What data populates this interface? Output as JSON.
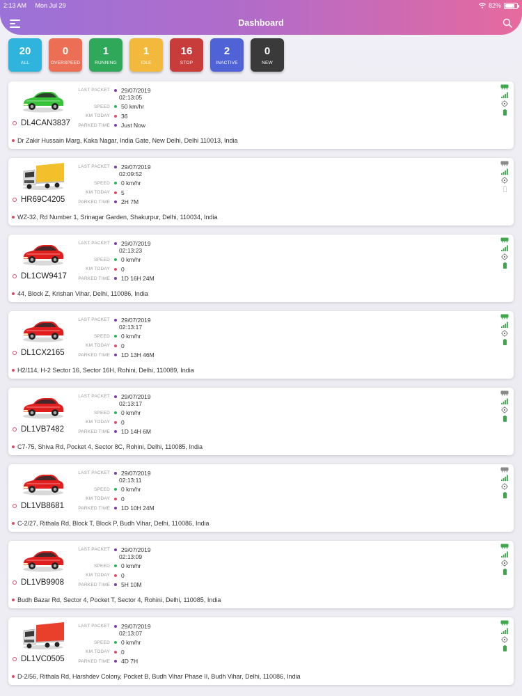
{
  "status_bar": {
    "time": "2:13 AM",
    "date": "Mon Jul 29",
    "battery": "82%",
    "battery_level": 0.82
  },
  "header": {
    "title": "Dashboard"
  },
  "tiles": [
    {
      "count": "20",
      "label": "ALL",
      "color": "#2fb4dd"
    },
    {
      "count": "0",
      "label": "OVERSPEED",
      "color": "#ec6f55"
    },
    {
      "count": "1",
      "label": "RUNNING",
      "color": "#2fa85a"
    },
    {
      "count": "1",
      "label": "IDLE",
      "color": "#f2b93d"
    },
    {
      "count": "16",
      "label": "STOP",
      "color": "#c93c3c"
    },
    {
      "count": "2",
      "label": "INACTIVE",
      "color": "#4f63d6"
    },
    {
      "count": "0",
      "label": "NEW",
      "color": "#3a3a3a"
    }
  ],
  "labels": {
    "last_packet": "LAST PACKET",
    "speed": "SPEED",
    "km_today": "KM TODAY",
    "parked_time": "PARKED TIME"
  },
  "colors": {
    "dot_last_packet": "#7a3fa0",
    "dot_speed": "#2fb45a",
    "dot_km": "#e24a6a",
    "dot_parked": "#7a3fa0",
    "gps_active": "#3fa64b",
    "gps_inactive": "#8a8a8a",
    "signal": "#3fa64b",
    "battery_on": "#3fa64b",
    "battery_off": "#bdbdbd"
  },
  "vehicles": [
    {
      "type": "car",
      "color": "#37c23a",
      "plate": "DL4CAN3837",
      "date": "29/07/2019",
      "time": "02:13:05",
      "speed": "50 km/hr",
      "km_today": "36",
      "parked": "Just Now",
      "address": "Dr Zakir Hussain Marg, Kaka Nagar, India Gate, New Delhi, Delhi 110013, India",
      "gps": "active",
      "battery": "on"
    },
    {
      "type": "truck",
      "color": "#f2c02a",
      "plate": "HR69C4205",
      "date": "29/07/2019",
      "time": "02:09:52",
      "speed": "0 km/hr",
      "km_today": "5",
      "parked": "2H 7M",
      "address": "WZ-32, Rd Number 1, Srinagar Garden, Shakurpur, Delhi, 110034, India",
      "gps": "inactive",
      "battery": "off"
    },
    {
      "type": "car",
      "color": "#e01e1e",
      "plate": "DL1CW9417",
      "date": "29/07/2019",
      "time": "02:13:23",
      "speed": "0 km/hr",
      "km_today": "0",
      "parked": "1D 16H 24M",
      "address": "44, Block Z, Krishan Vihar, Delhi, 110086, India",
      "gps": "active",
      "battery": "on"
    },
    {
      "type": "car",
      "color": "#e01e1e",
      "plate": "DL1CX2165",
      "date": "29/07/2019",
      "time": "02:13:17",
      "speed": "0 km/hr",
      "km_today": "0",
      "parked": "1D 13H 46M",
      "address": "H2/114, H-2 Sector 16, Sector 16H, Rohini, Delhi, 110089, India",
      "gps": "active",
      "battery": "on"
    },
    {
      "type": "car",
      "color": "#e01e1e",
      "plate": "DL1VB7482",
      "date": "29/07/2019",
      "time": "02:13:17",
      "speed": "0 km/hr",
      "km_today": "0",
      "parked": "1D 14H 6M",
      "address": "C7-75, Shiva Rd, Pocket 4, Sector 8C, Rohini, Delhi, 110085, India",
      "gps": "inactive",
      "battery": "on"
    },
    {
      "type": "car",
      "color": "#e01e1e",
      "plate": "DL1VB8681",
      "date": "29/07/2019",
      "time": "02:13:11",
      "speed": "0 km/hr",
      "km_today": "0",
      "parked": "1D 10H 24M",
      "address": "C-2/27, Rithala Rd, Block T, Block P, Budh Vihar, Delhi, 110086, India",
      "gps": "inactive",
      "battery": "on"
    },
    {
      "type": "car",
      "color": "#e01e1e",
      "plate": "DL1VB9908",
      "date": "29/07/2019",
      "time": "02:13:09",
      "speed": "0 km/hr",
      "km_today": "0",
      "parked": "5H 10M",
      "address": "Budh Bazar Rd, Sector 4, Pocket T, Sector 4, Rohini, Delhi, 110085, India",
      "gps": "active",
      "battery": "on"
    },
    {
      "type": "truck",
      "color": "#e8402a",
      "plate": "DL1VC0505",
      "date": "29/07/2019",
      "time": "02:13:07",
      "speed": "0 km/hr",
      "km_today": "0",
      "parked": "4D 7H",
      "address": "D-2/56, Rithala Rd, Harshdev Colony, Pocket B, Budh Vihar Phase II, Budh Vihar, Delhi, 110086, India",
      "gps": "active",
      "battery": "on"
    }
  ]
}
